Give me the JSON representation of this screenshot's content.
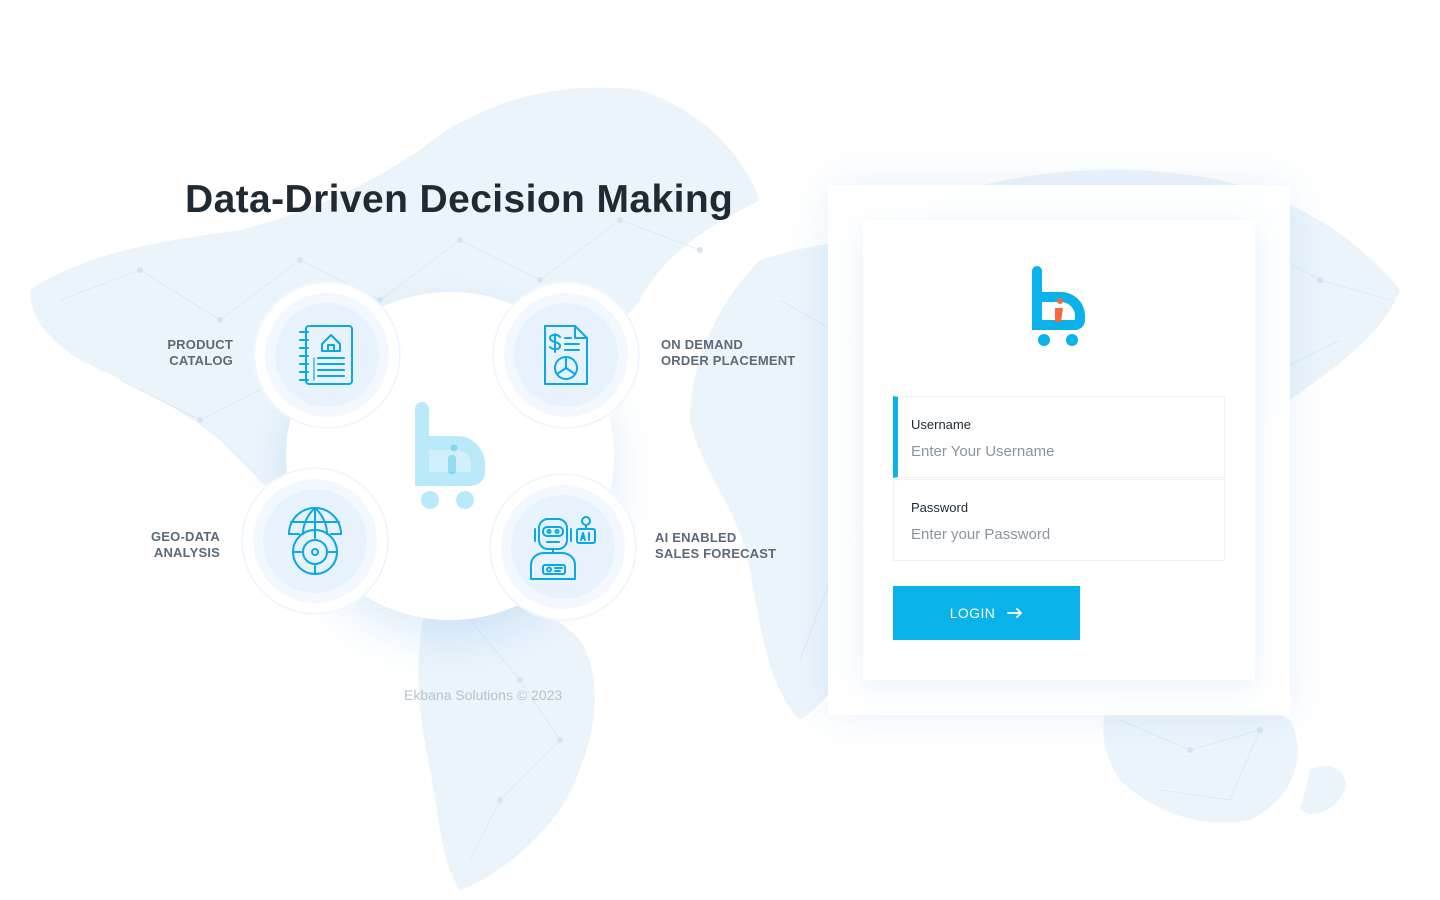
{
  "hero": {
    "headline": "Data-Driven Decision Making"
  },
  "features": [
    {
      "label": "PRODUCT\nCATALOG",
      "icon": "catalog-notebook-icon"
    },
    {
      "label": "ON DEMAND\nORDER PLACEMENT",
      "icon": "invoice-chart-icon"
    },
    {
      "label": "GEO-DATA\nANALYSIS",
      "icon": "globe-target-icon"
    },
    {
      "label": "AI ENABLED\nSALES FORECAST",
      "icon": "ai-robot-icon"
    }
  ],
  "footer": {
    "copyright": "Ekbana Solutions © 2023"
  },
  "login": {
    "logo_icon": "cart-bi-logo-icon",
    "username_label": "Username",
    "username_placeholder": "Enter Your Username",
    "password_label": "Password",
    "password_placeholder": "Enter your Password",
    "button_label": "LOGIN",
    "button_icon": "arrow-right-icon"
  },
  "colors": {
    "accent": "#0ab2ea",
    "logo_orange": "#f26a3d",
    "heading": "#1f2a33",
    "label": "#5b6a79",
    "muted": "#b9c3cc"
  }
}
